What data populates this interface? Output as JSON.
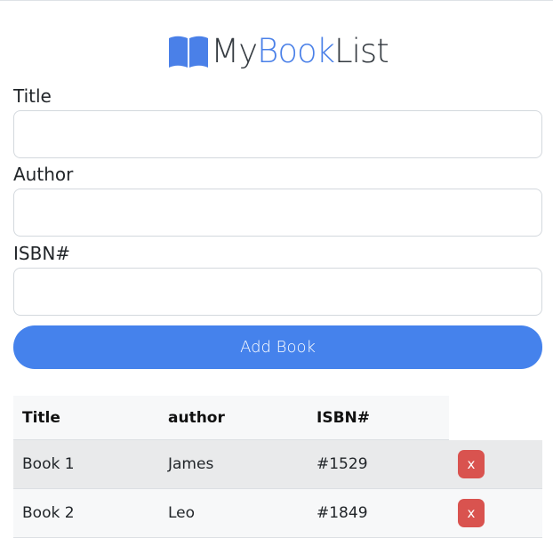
{
  "brand": {
    "part1": "My",
    "part2": "Book",
    "part3": "List",
    "icon": "book-open-icon",
    "accent_color": "#4a80e8"
  },
  "form": {
    "title_label": "Title",
    "title_value": "",
    "author_label": "Author",
    "author_value": "",
    "isbn_label": "ISBN#",
    "isbn_value": "",
    "submit_label": "Add Book",
    "submit_color": "#4582ec"
  },
  "table": {
    "headers": [
      "Title",
      "author",
      "ISBN#"
    ],
    "rows": [
      {
        "title": "Book 1",
        "author": "James",
        "isbn": "#1529",
        "delete_label": "x"
      },
      {
        "title": "Book 2",
        "author": "Leo",
        "isbn": "#1849",
        "delete_label": "x"
      }
    ],
    "delete_color": "#d9534f"
  }
}
